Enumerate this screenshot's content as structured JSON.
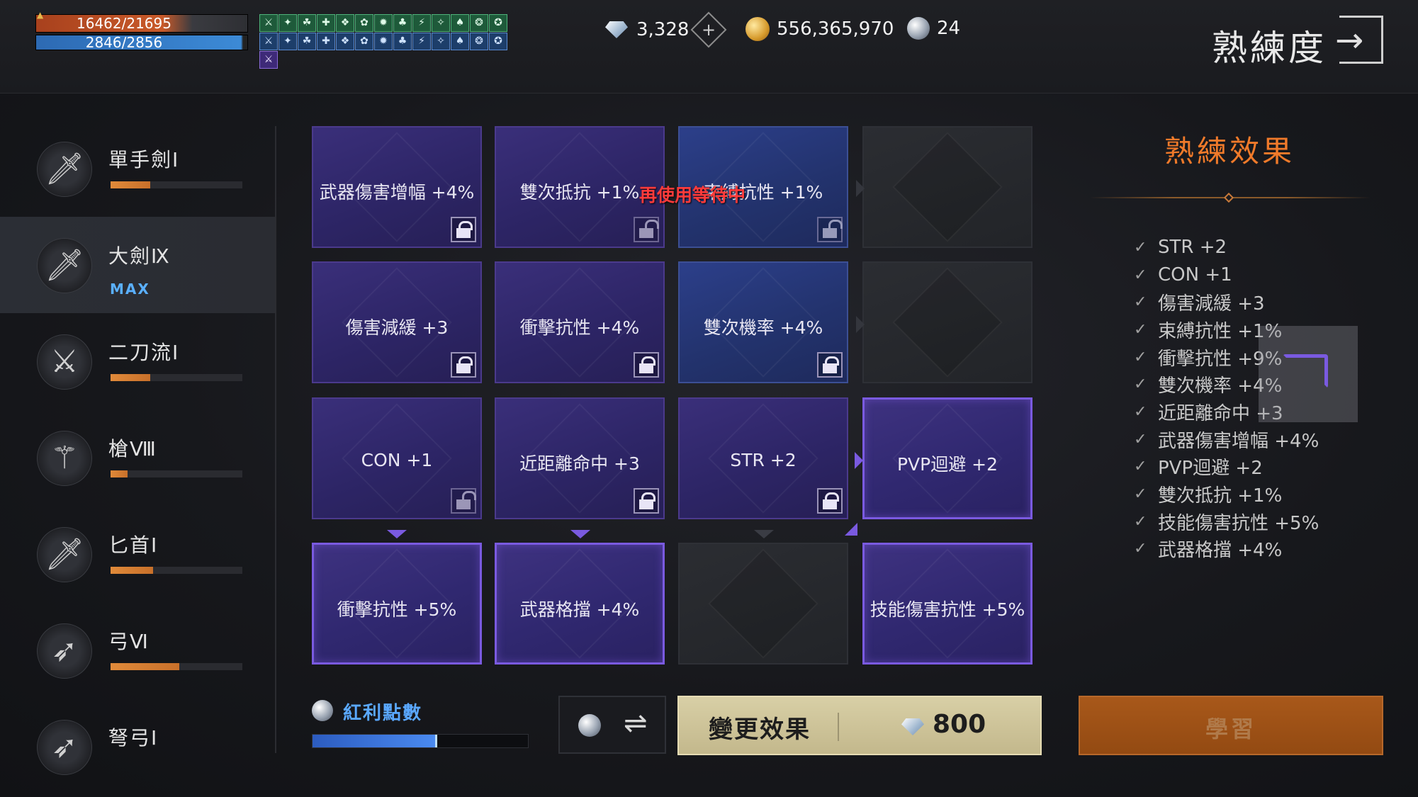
{
  "player": {
    "hp": "16462/21695",
    "mp": "2846/2856"
  },
  "buffs": {
    "row1": [
      "green",
      "green",
      "green",
      "green",
      "green",
      "green",
      "green",
      "green",
      "green",
      "green",
      "green",
      "green",
      "green"
    ],
    "row2": [
      "blue",
      "blue",
      "blue",
      "blue",
      "blue",
      "blue",
      "blue",
      "blue",
      "blue",
      "blue",
      "blue",
      "blue",
      "blue"
    ],
    "row3": [
      "purple"
    ]
  },
  "currency": {
    "diamonds": "3,328",
    "gold": "556,365,970",
    "orbs": "24"
  },
  "header": {
    "title": "熟練度"
  },
  "weapons": [
    {
      "name": "單手劍Ⅰ",
      "icon": "sword-icon",
      "progress": 0.3
    },
    {
      "name": "大劍Ⅸ",
      "icon": "greatsword-icon",
      "max": "MAX",
      "active": true
    },
    {
      "name": "二刀流Ⅰ",
      "icon": "dual-blades-icon",
      "progress": 0.3
    },
    {
      "name": "槍Ⅷ",
      "icon": "spear-icon",
      "progress": 0.13
    },
    {
      "name": "匕首Ⅰ",
      "icon": "dagger-icon",
      "progress": 0.32
    },
    {
      "name": "弓Ⅵ",
      "icon": "bow-icon",
      "progress": 0.52
    },
    {
      "name": "弩弓Ⅰ",
      "icon": "crossbow-icon"
    }
  ],
  "grid": {
    "cooldown_text": "再使用等待中",
    "cells": [
      {
        "label": "武器傷害增幅 +4%",
        "style": "purple",
        "lock": "locked"
      },
      {
        "label": "雙次抵抗 +1%",
        "style": "purple",
        "lock": "open"
      },
      {
        "label": "束縛抗性 +1%",
        "style": "blue",
        "lock": "open"
      },
      {
        "label": "",
        "style": "dark",
        "lock": "none"
      },
      {
        "label": "傷害減緩 +3",
        "style": "purple",
        "lock": "locked"
      },
      {
        "label": "衝擊抗性 +4%",
        "style": "purple",
        "lock": "locked"
      },
      {
        "label": "雙次機率 +4%",
        "style": "blue",
        "lock": "locked"
      },
      {
        "label": "",
        "style": "dark",
        "lock": "none"
      },
      {
        "label": "CON +1",
        "style": "purple",
        "lock": "open"
      },
      {
        "label": "近距離命中 +3",
        "style": "purple",
        "lock": "locked"
      },
      {
        "label": "STR +2",
        "style": "purple",
        "lock": "locked"
      },
      {
        "label": "PVP迴避 +2",
        "style": "sel",
        "lock": "none"
      },
      {
        "label": "衝擊抗性 +5%",
        "style": "sel",
        "lock": "none"
      },
      {
        "label": "武器格擋 +4%",
        "style": "sel",
        "lock": "none"
      },
      {
        "label": "",
        "style": "dark",
        "lock": "none"
      },
      {
        "label": "技能傷害抗性 +5%",
        "style": "sel",
        "lock": "none"
      }
    ]
  },
  "bonus": {
    "label": "紅利點數",
    "progress": 0.58
  },
  "actions": {
    "swap_symbol": "⇌",
    "change_label": "變更效果",
    "change_cost": "800",
    "learn_label": "學習"
  },
  "effects": {
    "title": "熟練效果",
    "items": [
      "STR +2",
      "CON +1",
      "傷害減緩 +3",
      "束縛抗性 +1%",
      "衝擊抗性 +9%",
      "雙次機率 +4%",
      "近距離命中 +3",
      "武器傷害增幅 +4%",
      "PVP迴避 +2",
      "雙次抵抗 +1%",
      "技能傷害抗性 +5%",
      "武器格擋 +4%"
    ]
  }
}
